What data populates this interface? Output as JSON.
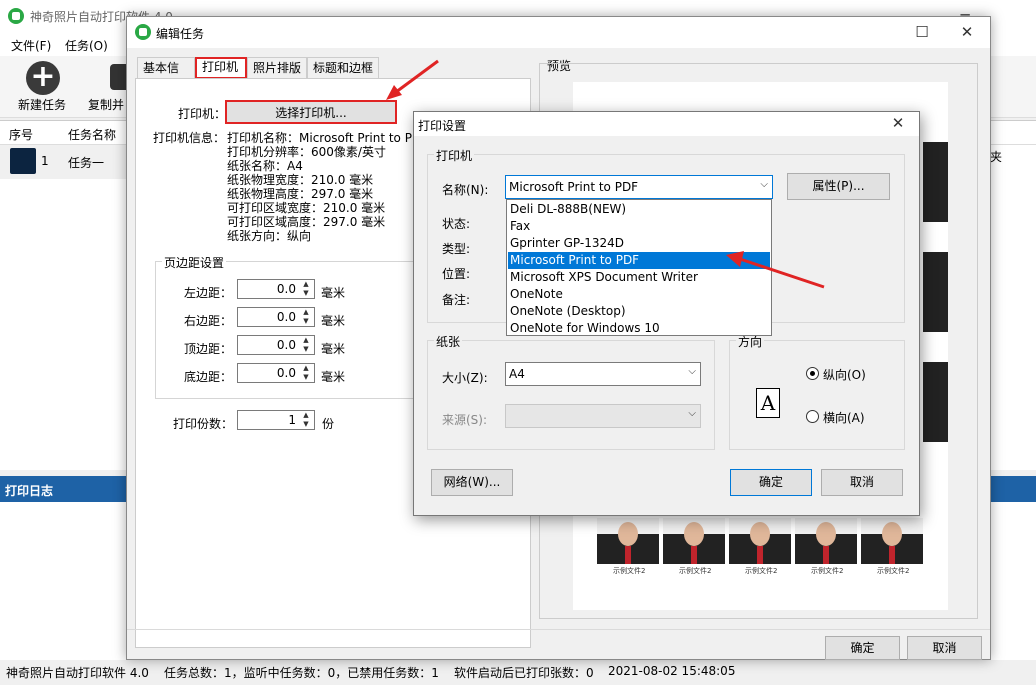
{
  "app": {
    "title": "神奇照片自动打印软件 4.0",
    "menu": [
      "文件(F)",
      "任务(O)"
    ],
    "toolbar": {
      "new_task": "新建任务",
      "copy_task": "复制并"
    },
    "grid": {
      "col_index": "序号",
      "col_name": "任务名称",
      "right_col_fragment": "夹",
      "row_index": "1",
      "row_name": "任务一"
    },
    "log_title": "打印日志",
    "status": {
      "app_version": "神奇照片自动打印软件 4.0",
      "counts": "任务总数：1，监听中任务数：0，已禁用任务数：1",
      "printed": "软件启动后已打印张数：0",
      "datetime": "2021-08-02 15:48:05"
    }
  },
  "edit": {
    "title": "编辑任务",
    "tabs": [
      "基本信息",
      "打印机",
      "照片排版",
      "标题和边框"
    ],
    "printer_label": "打印机：",
    "select_printer_button": "选择打印机...",
    "printer_info_label": "打印机信息：",
    "printer_info": [
      "打印机名称：Microsoft Print to PDF",
      "打印机分辨率：600像素/英寸",
      "纸张名称：A4",
      "纸张物理宽度：210.0 毫米",
      "纸张物理高度：297.0 毫米",
      "可打印区域宽度：210.0 毫米",
      "可打印区域高度：297.0 毫米",
      "纸张方向：纵向"
    ],
    "margin_group": "页边距设置",
    "margins": [
      {
        "label": "左边距：",
        "value": "0.0",
        "unit": "毫米"
      },
      {
        "label": "右边距：",
        "value": "0.0",
        "unit": "毫米"
      },
      {
        "label": "顶边距：",
        "value": "0.0",
        "unit": "毫米"
      },
      {
        "label": "底边距：",
        "value": "0.0",
        "unit": "毫米"
      }
    ],
    "copies_label": "打印份数：",
    "copies_value": "1",
    "copies_unit": "份",
    "preview_title": "预览",
    "photo_caption": "示例文件2",
    "ok": "确定",
    "cancel": "取消"
  },
  "print_setup": {
    "title": "打印设置",
    "printer_group": "打印机",
    "name_label": "名称(N):",
    "selected_printer": "Microsoft Print to PDF",
    "properties_button": "属性(P)...",
    "status_label": "状态:",
    "type_label": "类型:",
    "where_label": "位置:",
    "comment_label": "备注:",
    "printer_options": [
      "Deli DL-888B(NEW)",
      "Fax",
      "Gprinter  GP-1324D",
      "Microsoft Print to PDF",
      "Microsoft XPS Document Writer",
      "OneNote",
      "OneNote (Desktop)",
      "OneNote for Windows 10"
    ],
    "paper_group": "纸张",
    "size_label": "大小(Z):",
    "size_value": "A4",
    "source_label": "来源(S):",
    "orientation_group": "方向",
    "portrait": "纵向(O)",
    "landscape": "横向(A)",
    "orientation_icon_letter": "A",
    "network_button": "网络(W)...",
    "ok": "确定",
    "cancel": "取消"
  },
  "colors": {
    "accent": "#0078d7",
    "highlight_red": "#e02424",
    "log_header": "#1e62a6"
  }
}
